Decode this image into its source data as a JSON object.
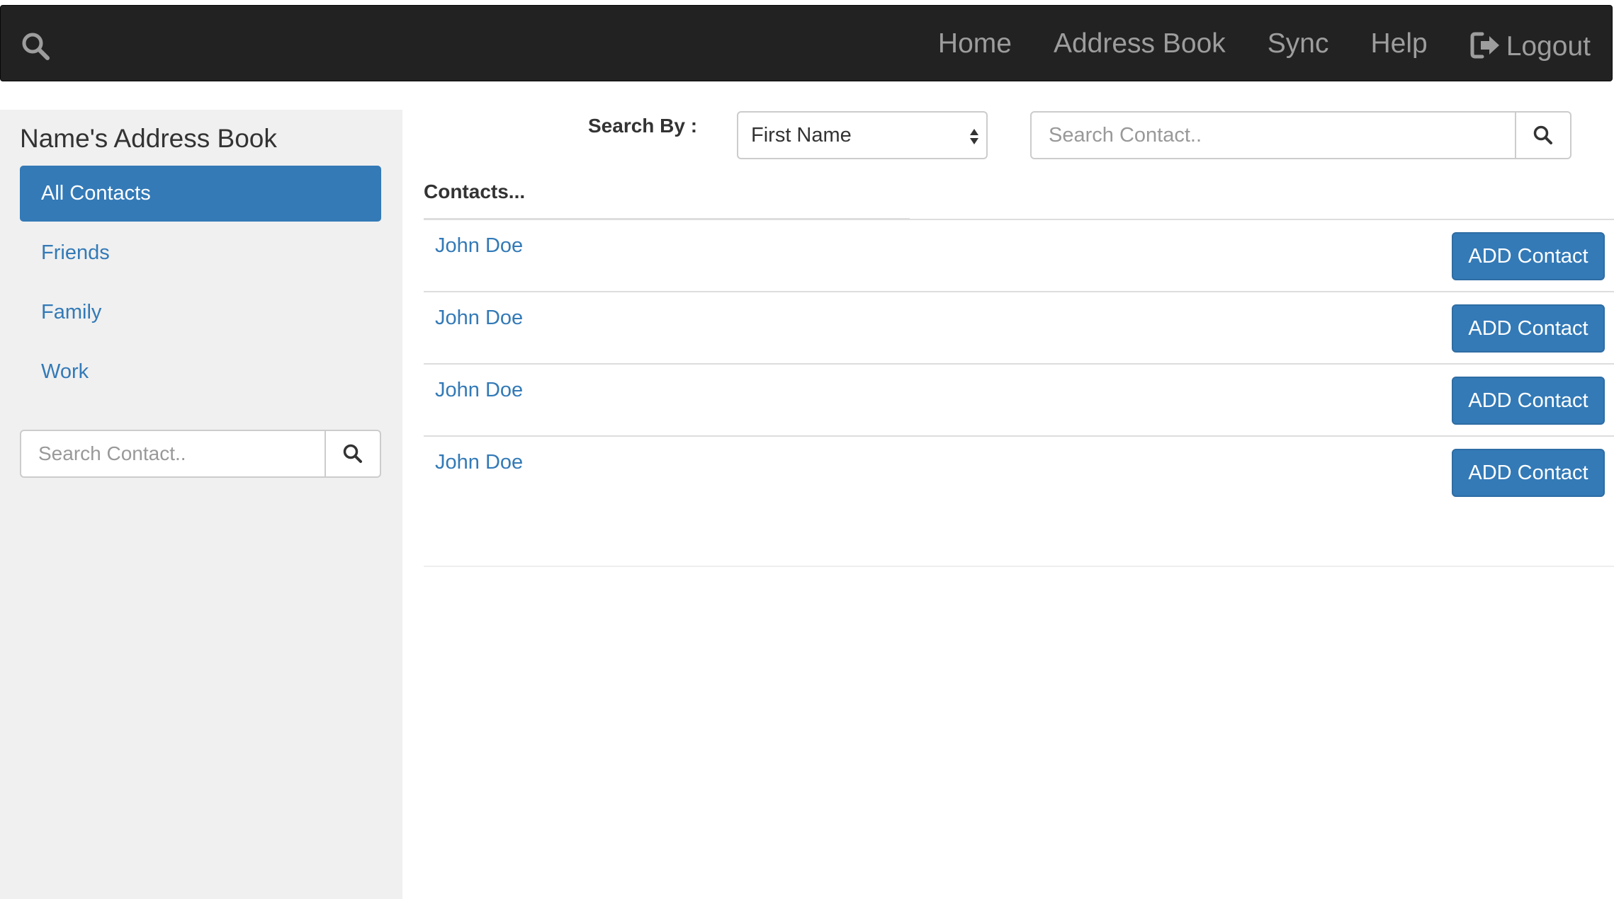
{
  "nav": {
    "search_icon": "search-icon",
    "links": [
      {
        "label": "Home"
      },
      {
        "label": "Address Book"
      },
      {
        "label": "Sync"
      },
      {
        "label": "Help"
      }
    ],
    "logout_label": "Logout",
    "logout_icon": "logout-icon"
  },
  "sidebar": {
    "title": "Name's Address Book",
    "items": [
      {
        "label": "All Contacts",
        "active": true
      },
      {
        "label": "Friends",
        "active": false
      },
      {
        "label": "Family",
        "active": false
      },
      {
        "label": "Work",
        "active": false
      }
    ],
    "search": {
      "placeholder": "Search Contact..",
      "icon": "search-icon"
    }
  },
  "main": {
    "search_by_label": "Search By :",
    "search_by_value": "First Name",
    "search": {
      "placeholder": "Search Contact..",
      "icon": "search-icon"
    },
    "contacts_header": "Contacts...",
    "contacts": [
      {
        "name": "John Doe",
        "button": "ADD Contact"
      },
      {
        "name": "John Doe",
        "button": "ADD Contact"
      },
      {
        "name": "John Doe",
        "button": "ADD Contact"
      },
      {
        "name": "John Doe",
        "button": "ADD Contact"
      }
    ]
  },
  "colors": {
    "navbar_bg": "#222222",
    "nav_text": "#9d9d9d",
    "primary": "#337ab7",
    "sidebar_bg": "#f0f0f0"
  }
}
